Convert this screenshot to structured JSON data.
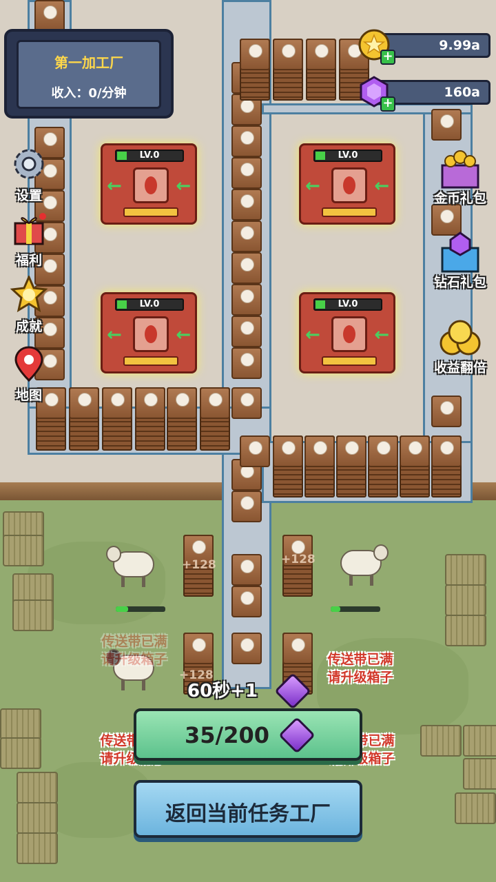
{
  "factory": {
    "name": "第一加工厂",
    "income": "收入：0/分钟"
  },
  "currency": {
    "coins": {
      "value": "9.99a",
      "icon": "gold-coin-icon"
    },
    "gems": {
      "value": "160a",
      "icon": "purple-gem-icon"
    }
  },
  "left_menu": [
    {
      "label": "设置",
      "icon": "gear-icon"
    },
    {
      "label": "福利",
      "icon": "gift-icon"
    },
    {
      "label": "成就",
      "icon": "star-badge-icon"
    },
    {
      "label": "地图",
      "icon": "map-pin-icon"
    }
  ],
  "right_menu": [
    {
      "label": "金币礼包",
      "icon": "coin-gift-box-icon"
    },
    {
      "label": "钻石礼包",
      "icon": "diamond-gift-box-icon"
    },
    {
      "label": "收益翻倍",
      "icon": "coin-stack-icon"
    }
  ],
  "machines": [
    {
      "level": "LV.0"
    },
    {
      "level": "LV.0"
    },
    {
      "level": "LV.0"
    },
    {
      "level": "LV.0"
    }
  ],
  "floating": {
    "plus128": "+128",
    "plus128_b": "+128",
    "plus128_c": "+128"
  },
  "warnings": {
    "line1": "传送带已满",
    "line2": "请升级箱子"
  },
  "reward": {
    "text": "60秒+1"
  },
  "gem_progress": {
    "text": "35/200",
    "current": 35,
    "max": 200
  },
  "return_button": {
    "label": "返回当前任务工厂"
  },
  "colors": {
    "accent_green": "#5cc28c",
    "accent_blue": "#6cb4de",
    "warning_red": "#d2382a",
    "title_yellow": "#ffd84a"
  }
}
